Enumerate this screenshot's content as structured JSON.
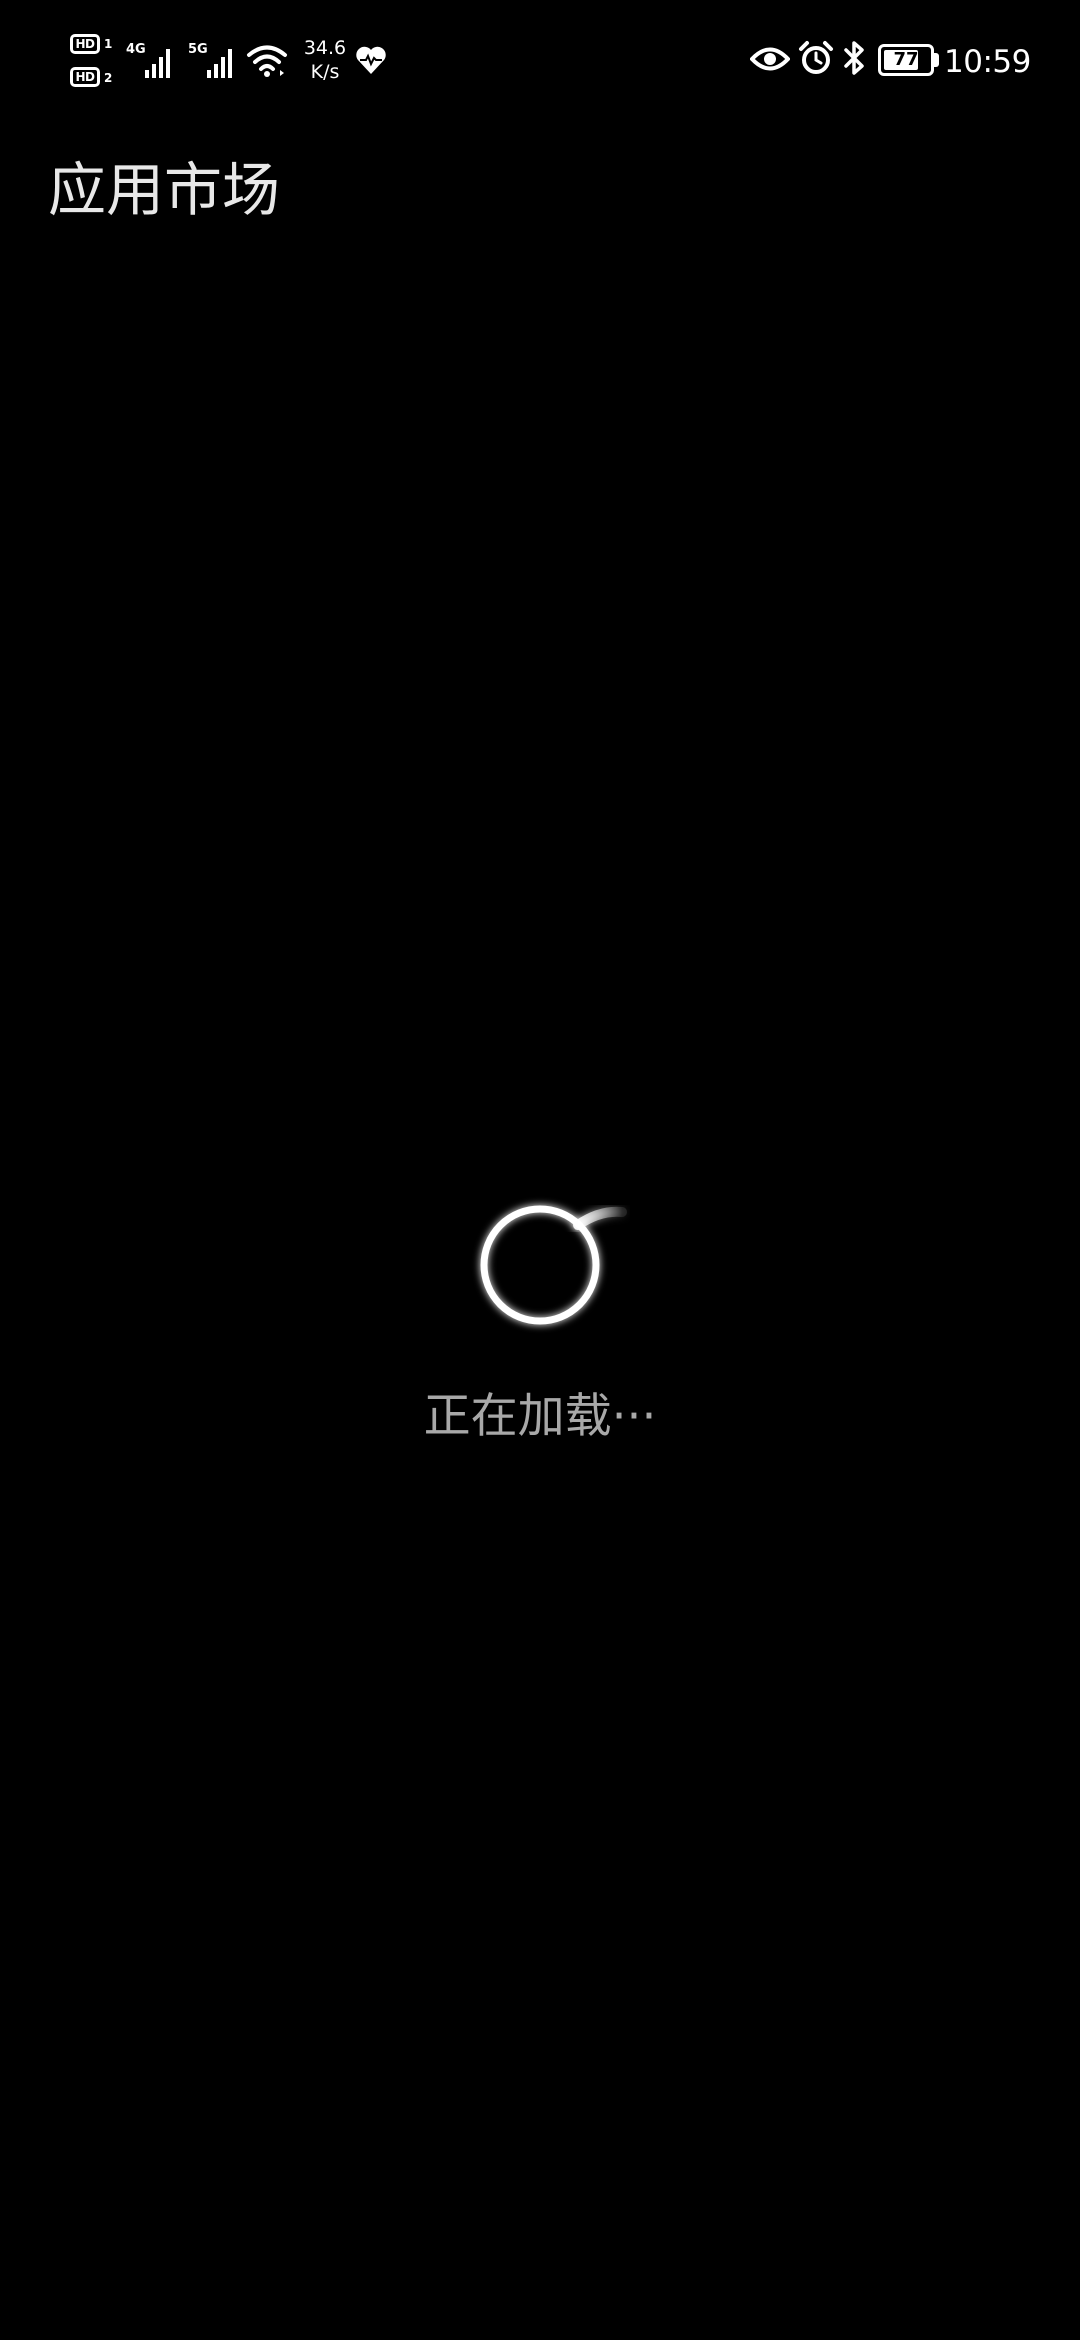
{
  "status_bar": {
    "sim1_badge": "HD",
    "sim1_number": "1",
    "sim2_badge": "HD",
    "sim2_number": "2",
    "sim1_network": "4G",
    "sim2_network": "5G",
    "speed_value": "34.6",
    "speed_unit": "K/s",
    "battery_level": "77",
    "time": "10:59",
    "icons": [
      "signal-icon",
      "wifi-icon",
      "heart-icon",
      "eye-icon",
      "alarm-icon",
      "bluetooth-icon",
      "battery-icon"
    ]
  },
  "header": {
    "title": "应用市场"
  },
  "loading": {
    "text": "正在加载···"
  },
  "colors": {
    "background": "#000000",
    "title": "#e8e8e8",
    "loading_text": "#a8a8a8",
    "icons": "#ffffff"
  }
}
